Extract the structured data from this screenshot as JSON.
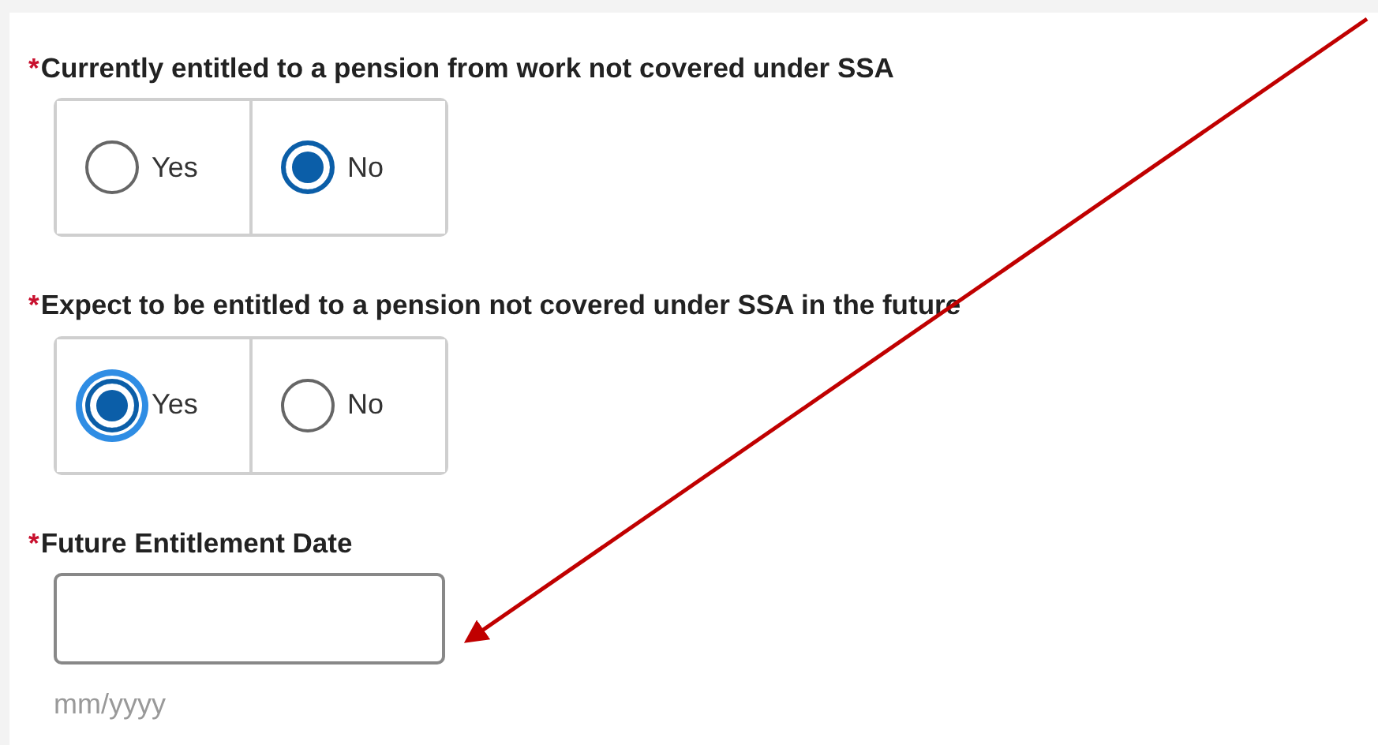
{
  "questions": [
    {
      "kind": "radio",
      "required_marker": "*",
      "label": "Currently entitled to a pension from work not covered under SSA",
      "options": [
        {
          "label": "Yes",
          "selected": false,
          "focused": false
        },
        {
          "label": "No",
          "selected": true,
          "focused": false
        }
      ]
    },
    {
      "kind": "radio",
      "required_marker": "*",
      "label": "Expect to be entitled to a pension not covered under SSA in the future",
      "options": [
        {
          "label": "Yes",
          "selected": true,
          "focused": true
        },
        {
          "label": "No",
          "selected": false,
          "focused": false
        }
      ]
    },
    {
      "kind": "date",
      "required_marker": "*",
      "label": "Future Entitlement Date",
      "hint": "mm/yyyy"
    }
  ]
}
